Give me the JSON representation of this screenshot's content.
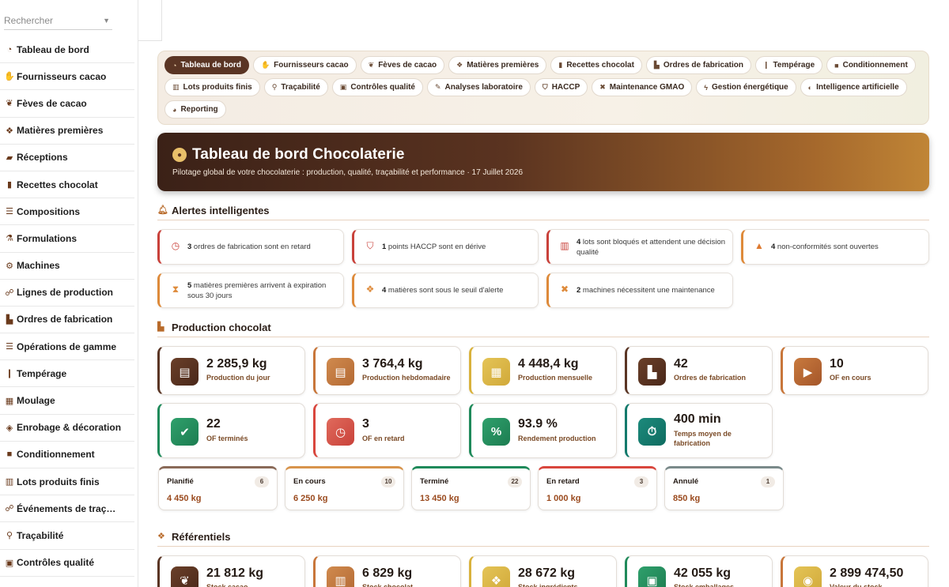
{
  "search": {
    "placeholder": "Rechercher"
  },
  "sidebar": {
    "items": [
      {
        "label": "Tableau de bord",
        "icon": "gauge-icon",
        "glyph": "◔"
      },
      {
        "label": "Fournisseurs cacao",
        "icon": "handshake-icon",
        "glyph": "✋"
      },
      {
        "label": "Fèves de cacao",
        "icon": "seedling-icon",
        "glyph": "❦"
      },
      {
        "label": "Matières premières",
        "icon": "cubes-icon",
        "glyph": "❖"
      },
      {
        "label": "Réceptions",
        "icon": "truck-icon",
        "glyph": "▰"
      },
      {
        "label": "Recettes chocolat",
        "icon": "book-icon",
        "glyph": "▮"
      },
      {
        "label": "Compositions",
        "icon": "list-icon",
        "glyph": "☰"
      },
      {
        "label": "Formulations",
        "icon": "flask-icon",
        "glyph": "⚗"
      },
      {
        "label": "Machines",
        "icon": "cogs-icon",
        "glyph": "⚙"
      },
      {
        "label": "Lignes de production",
        "icon": "sitemap-icon",
        "glyph": "☍"
      },
      {
        "label": "Ordres de fabrication",
        "icon": "industry-icon",
        "glyph": "▙"
      },
      {
        "label": "Opérations de gamme",
        "icon": "list-check-icon",
        "glyph": "☰"
      },
      {
        "label": "Tempérage",
        "icon": "thermometer-icon",
        "glyph": "❙"
      },
      {
        "label": "Moulage",
        "icon": "grid-icon",
        "glyph": "▦"
      },
      {
        "label": "Enrobage & décoration",
        "icon": "candy-icon",
        "glyph": "◈"
      },
      {
        "label": "Conditionnement",
        "icon": "box-icon",
        "glyph": "■"
      },
      {
        "label": "Lots produits finis",
        "icon": "barcode-icon",
        "glyph": "▥"
      },
      {
        "label": "Événements de traç…",
        "icon": "network-icon",
        "glyph": "☍"
      },
      {
        "label": "Traçabilité",
        "icon": "search-icon",
        "glyph": "⚲"
      },
      {
        "label": "Contrôles qualité",
        "icon": "clipboard-check-icon",
        "glyph": "▣"
      }
    ]
  },
  "tabs": [
    [
      {
        "label": "Tableau de bord",
        "icon": "gauge-icon",
        "glyph": "◔",
        "active": true
      },
      {
        "label": "Fournisseurs cacao",
        "icon": "handshake-icon",
        "glyph": "✋"
      },
      {
        "label": "Fèves de cacao",
        "icon": "seedling-icon",
        "glyph": "❦"
      },
      {
        "label": "Matières premières",
        "icon": "cubes-icon",
        "glyph": "❖"
      },
      {
        "label": "Recettes chocolat",
        "icon": "book-icon",
        "glyph": "▮"
      },
      {
        "label": "Ordres de fabrication",
        "icon": "industry-icon",
        "glyph": "▙"
      },
      {
        "label": "Tempérage",
        "icon": "thermometer-icon",
        "glyph": "❙"
      },
      {
        "label": "Conditionnement",
        "icon": "box-icon",
        "glyph": "■"
      }
    ],
    [
      {
        "label": "Lots produits finis",
        "icon": "barcode-icon",
        "glyph": "▥"
      },
      {
        "label": "Traçabilité",
        "icon": "search-icon",
        "glyph": "⚲"
      },
      {
        "label": "Contrôles qualité",
        "icon": "clipboard-check-icon",
        "glyph": "▣"
      },
      {
        "label": "Analyses laboratoire",
        "icon": "vial-icon",
        "glyph": "✎"
      },
      {
        "label": "HACCP",
        "icon": "shield-icon",
        "glyph": "⛉"
      },
      {
        "label": "Maintenance GMAO",
        "icon": "tools-icon",
        "glyph": "✖"
      },
      {
        "label": "Gestion énergétique",
        "icon": "bolt-icon",
        "glyph": "ϟ"
      },
      {
        "label": "Intelligence artificielle",
        "icon": "brain-icon",
        "glyph": "◐"
      }
    ],
    [
      {
        "label": "Reporting",
        "icon": "chart-pie-icon",
        "glyph": "◕"
      }
    ]
  ],
  "hero": {
    "title": "Tableau de bord Chocolaterie",
    "subtitle": "Pilotage global de votre chocolaterie : production, qualité, traçabilité et performance · 17 Juillet 2026"
  },
  "alerts_section": {
    "title": "Alertes intelligentes"
  },
  "alerts": [
    {
      "count": "3",
      "text": "ordres de fabrication sont en retard",
      "tone": "red",
      "icon": "clock-icon",
      "glyph": "◷",
      "color": "#c9413a"
    },
    {
      "count": "1",
      "text": "points HACCP sont en dérive",
      "tone": "red",
      "icon": "shield-icon",
      "glyph": "⛉",
      "color": "#c9413a"
    },
    {
      "count": "4",
      "text": "lots sont bloqués et attendent une décision qualité",
      "tone": "red",
      "icon": "barcode-icon",
      "glyph": "▥",
      "color": "#c9413a"
    },
    {
      "count": "4",
      "text": "non-conformités sont ouvertes",
      "tone": "orange",
      "icon": "warning-icon",
      "glyph": "▲",
      "color": "#de7a30"
    },
    {
      "count": "5",
      "text": "matières premières arrivent à expiration sous 30 jours",
      "tone": "orange",
      "icon": "hourglass-icon",
      "glyph": "⧗",
      "color": "#de8a3a"
    },
    {
      "count": "4",
      "text": "matières sont sous le seuil d'alerte",
      "tone": "orange",
      "icon": "cubes-icon",
      "glyph": "❖",
      "color": "#de8a3a"
    },
    {
      "count": "2",
      "text": "machines nécessitent une maintenance",
      "tone": "orange",
      "icon": "tools-icon",
      "glyph": "✖",
      "color": "#de8a3a"
    }
  ],
  "production_section": {
    "title": "Production chocolat"
  },
  "kpis": [
    {
      "value": "2 285,9 kg",
      "label": "Production du jour",
      "icon": "calendar-day-icon",
      "glyph": "▤"
    },
    {
      "value": "3 764,4 kg",
      "label": "Production hebdomadaire",
      "icon": "calendar-week-icon",
      "glyph": "▤"
    },
    {
      "value": "4 448,4 kg",
      "label": "Production mensuelle",
      "icon": "calendar-month-icon",
      "glyph": "▦"
    },
    {
      "value": "42",
      "label": "Ordres de fabrication",
      "icon": "industry-icon",
      "glyph": "▙"
    },
    {
      "value": "10",
      "label": "OF en cours",
      "icon": "play-circle-icon",
      "glyph": "▶"
    },
    {
      "value": "22",
      "label": "OF terminés",
      "icon": "check-circle-icon",
      "glyph": "✔"
    },
    {
      "value": "3",
      "label": "OF en retard",
      "icon": "clock-icon",
      "glyph": "◷"
    },
    {
      "value": "93.9 %",
      "label": "Rendement production",
      "icon": "percent-icon",
      "glyph": "%"
    },
    {
      "value": "400 min",
      "label": "Temps moyen de fabrication",
      "icon": "stopwatch-icon",
      "glyph": "⏱"
    }
  ],
  "statuses": [
    {
      "label": "Planifié",
      "count": "6",
      "value": "4 450 kg"
    },
    {
      "label": "En cours",
      "count": "10",
      "value": "6 250 kg"
    },
    {
      "label": "Terminé",
      "count": "22",
      "value": "13 450 kg"
    },
    {
      "label": "En retard",
      "count": "3",
      "value": "1 000 kg"
    },
    {
      "label": "Annulé",
      "count": "1",
      "value": "850 kg"
    }
  ],
  "referentiels_section": {
    "title": "Référentiels"
  },
  "ref_kpis": [
    {
      "value": "21 812 kg",
      "label": "Stock cacao",
      "icon": "seedling-icon",
      "glyph": "❦"
    },
    {
      "value": "6 829 kg",
      "label": "Stock chocolat",
      "icon": "barcode-icon",
      "glyph": "▥"
    },
    {
      "value": "28 672 kg",
      "label": "Stock ingrédients",
      "icon": "cubes-icon",
      "glyph": "❖"
    },
    {
      "value": "42 055 kg",
      "label": "Stock emballages",
      "icon": "box-open-icon",
      "glyph": "▣"
    },
    {
      "value": "2 899 474,50",
      "label": "Valeur du stock",
      "icon": "coins-icon",
      "glyph": "◉"
    }
  ]
}
